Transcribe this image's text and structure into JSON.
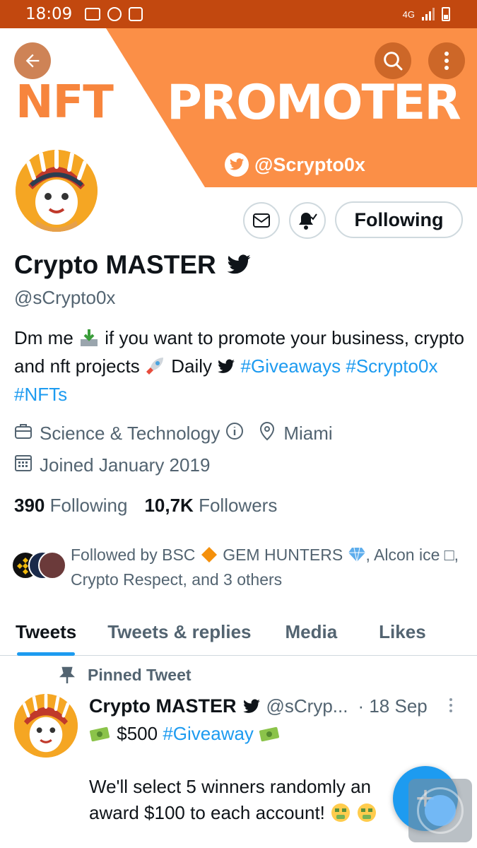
{
  "status_bar": {
    "time": "18:09",
    "network": "4G"
  },
  "banner": {
    "left_text": "NFT",
    "right_text": "PROMOTER",
    "handle": "@Scrypto0x",
    "colors": {
      "accent": "#fb8f47"
    }
  },
  "profile": {
    "display_name": "Crypto MASTER",
    "username": "@sCrypto0x",
    "following_button": "Following",
    "bio": {
      "part1": "Dm me",
      "part2": "if you want to promote your business, crypto and nft projects",
      "part3": "Daily",
      "hashtag1": "#Giveaways",
      "hashtag2": "#Scrypto0x",
      "hashtag3": "#NFTs"
    },
    "category": "Science & Technology",
    "location": "Miami",
    "joined": "Joined January 2019",
    "following_count": "390",
    "following_label": "Following",
    "followers_count": "10,7K",
    "followers_label": "Followers",
    "followed_by": {
      "prefix": "Followed by BSC",
      "name_mid": "GEM HUNTERS",
      "rest": ", Alcon ice □, Crypto Respect, and 3 others"
    }
  },
  "tabs": [
    {
      "label": "Tweets",
      "active": true
    },
    {
      "label": "Tweets & replies",
      "active": false
    },
    {
      "label": "Media",
      "active": false
    },
    {
      "label": "Likes",
      "active": false
    }
  ],
  "pinned_tweet": {
    "pinned_label": "Pinned Tweet",
    "author_name": "Crypto MASTER",
    "author_handle": "@sCryp...",
    "date": "· 18 Sep",
    "line1_amount": "$500",
    "line1_hashtag": "#Giveaway",
    "line2": "We'll select 5 winners randomly an",
    "line3": "award $100 to each account!"
  },
  "fab": {
    "icon": "compose-plus-icon",
    "label": "+"
  }
}
